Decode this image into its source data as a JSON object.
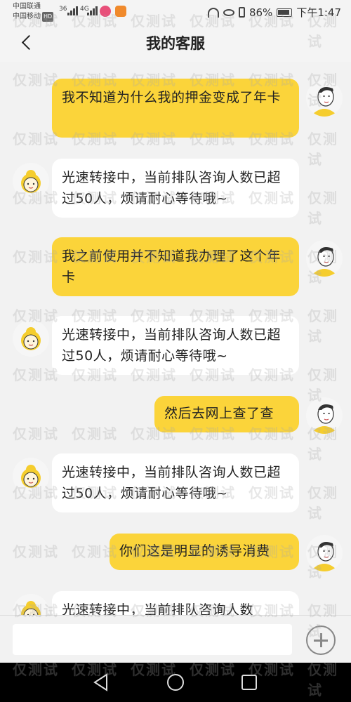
{
  "status_bar": {
    "carrier_1": "中国联通",
    "carrier_2": "中国移动",
    "hd_badge": "HD",
    "net_1": "36",
    "net_2": "4G",
    "battery_percent": "86%",
    "time": "下午1:47"
  },
  "header": {
    "title": "我的客服",
    "back_icon": "chevron-left-icon"
  },
  "messages": [
    {
      "sender": "user",
      "text": "我不知道为什么我的押金变成了年卡"
    },
    {
      "sender": "agent",
      "text": "光速转接中，当前排队咨询人数已超过50人，烦请耐心等待哦~"
    },
    {
      "sender": "user",
      "text": "我之前使用并不知道我办理了这个年卡"
    },
    {
      "sender": "agent",
      "text": "光速转接中，当前排队咨询人数已超过50人，烦请耐心等待哦~"
    },
    {
      "sender": "user",
      "text": "然后去网上查了查"
    },
    {
      "sender": "agent",
      "text": "光速转接中，当前排队咨询人数已超过50人，烦请耐心等待哦~"
    },
    {
      "sender": "user",
      "text": "你们这是明显的诱导消费"
    },
    {
      "sender": "agent",
      "text": "光速转接中，当前排队咨询人数"
    }
  ],
  "input": {
    "value": "",
    "placeholder": ""
  },
  "watermark": "仅测试",
  "colors": {
    "user_bubble": "#fbd43a",
    "agent_bubble": "#ffffff",
    "background": "#f2f2f2",
    "navbar": "#000000"
  }
}
